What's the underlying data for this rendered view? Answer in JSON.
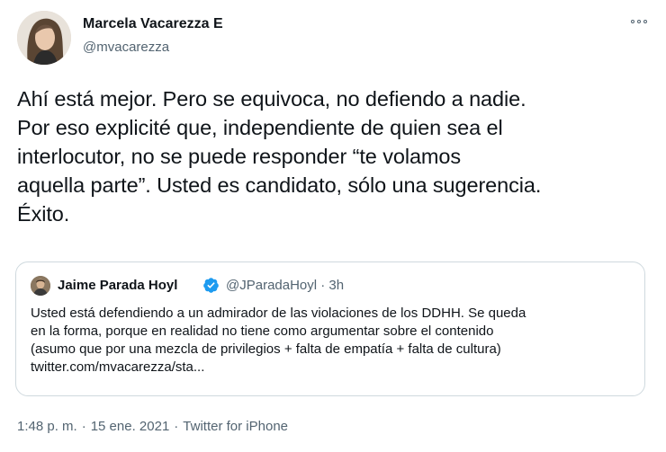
{
  "tweet": {
    "author_name": "Marcela Vacarezza E",
    "author_handle": "@mvacarezza",
    "more_icon": "more-horizontal-icon",
    "text": "Ahí está mejor. Pero se equivoca, no defiendo a nadie.\nPor eso explicité que, independiente de quien sea el\ninterlocutor, no se puede responder “te volamos\naquella parte”. Usted es candidato, sólo una sugerencia.\nÉxito.",
    "time": "1:48 p. m.",
    "date": "15 ene. 2021",
    "separator": "·",
    "source": "Twitter for iPhone"
  },
  "quote": {
    "author_name": "Jaime Parada Hoyl",
    "verified_icon": "verified-badge-icon",
    "verified_color": "#1d9bf0",
    "handle_time": "@JParadaHoyl · 3h",
    "text": "Usted está defendiendo a un admirador de las violaciones de los DDHH. Se queda\nen la forma, porque en realidad no tiene como argumentar sobre el contenido\n(asumo que por una mezcla de privilegios + falta de empatía + falta de cultura)\ntwitter.com/mvacarezza/sta..."
  },
  "colors": {
    "text_primary": "#0f1419",
    "text_secondary": "#536471",
    "border": "#cfd9de"
  }
}
